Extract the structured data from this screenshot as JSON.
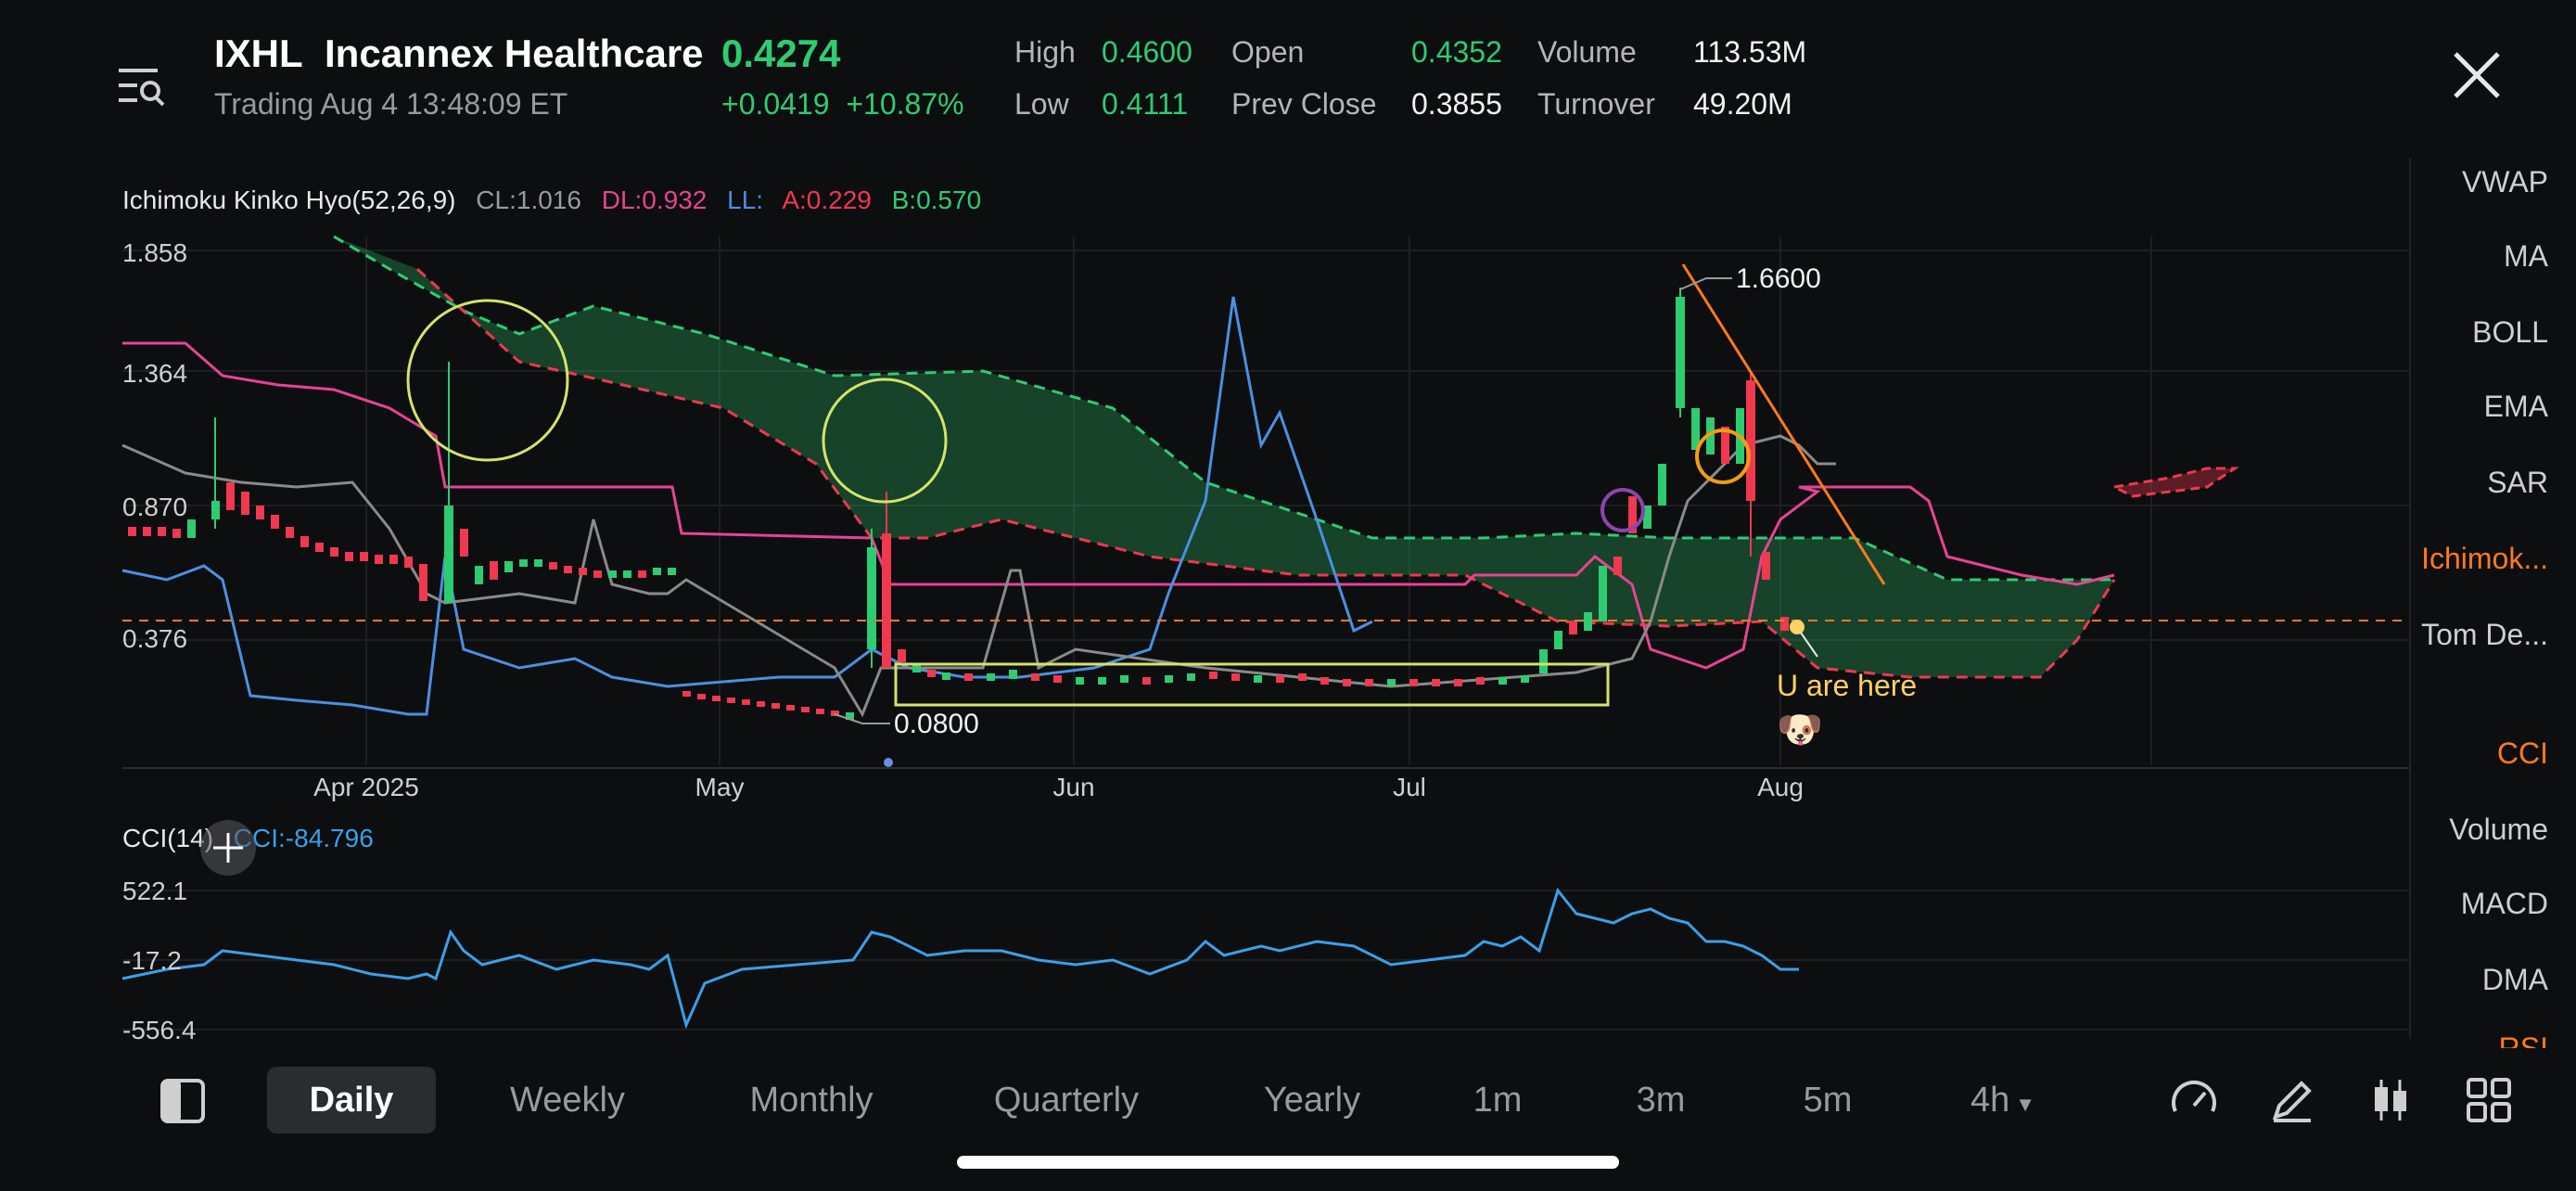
{
  "header": {
    "ticker": "IXHL",
    "name": "Incannex Healthcare",
    "price": "0.4274",
    "status": "Trading Aug 4 13:48:09 ET",
    "change": "+0.0419",
    "change_pct": "+10.87%",
    "quote": {
      "high_label": "High",
      "high": "0.4600",
      "low_label": "Low",
      "low": "0.4111",
      "open_label": "Open",
      "open": "0.4352",
      "prev_close_label": "Prev Close",
      "prev_close": "0.3855",
      "volume_label": "Volume",
      "volume": "113.53M",
      "turnover_label": "Turnover",
      "turnover": "49.20M"
    }
  },
  "indicator": {
    "name": "Ichimoku Kinko Hyo(52,26,9)",
    "cl": "CL:1.016",
    "dl": "DL:0.932",
    "ll": "LL:",
    "a": "A:0.229",
    "b": "B:0.570"
  },
  "main_chart": {
    "y_ticks": [
      "1.858",
      "1.364",
      "0.870",
      "0.376"
    ],
    "x_ticks": [
      "Apr 2025",
      "May",
      "Jun",
      "Jul",
      "Aug"
    ],
    "annotations": {
      "high_label": "1.6600",
      "low_label": "0.0800",
      "note": "U are here",
      "emoji": "🐶"
    }
  },
  "cci": {
    "name": "CCI(14)",
    "value": "CCI:-84.796",
    "y_ticks": [
      "522.1",
      "-17.2",
      "-556.4"
    ]
  },
  "sidebar": {
    "items": [
      "VWAP",
      "MA",
      "BOLL",
      "EMA",
      "SAR",
      "Ichimok...",
      "Tom De...",
      "CCI",
      "Volume",
      "MACD",
      "DMA",
      "RSI"
    ]
  },
  "tabs": [
    "Daily",
    "Weekly",
    "Monthly",
    "Quarterly",
    "Yearly",
    "1m",
    "3m",
    "5m",
    "4h"
  ],
  "colors": {
    "up": "#2ecc71",
    "down": "#f0384f",
    "accent": "#ff7a1a",
    "cci_line": "#3aa0e8",
    "dl_line": "#e84393",
    "ll_line": "#4a90e2"
  },
  "chart_data": {
    "type": "line",
    "x": [
      "Apr 2025",
      "May",
      "Jun",
      "Jul",
      "Aug"
    ],
    "ylim": [
      0.0,
      1.858
    ],
    "y_ticks": [
      1.858,
      1.364,
      0.87,
      0.376
    ],
    "series": [
      {
        "name": "DL",
        "values": [
          1.3,
          0.95,
          0.63,
          0.63,
          0.93
        ]
      },
      {
        "name": "LL",
        "values": [
          0.55,
          0.33,
          0.33,
          0.33,
          0.95
        ]
      },
      {
        "name": "CL",
        "values": [
          0.92,
          0.2,
          0.3,
          0.32,
          1.02
        ]
      }
    ]
  }
}
